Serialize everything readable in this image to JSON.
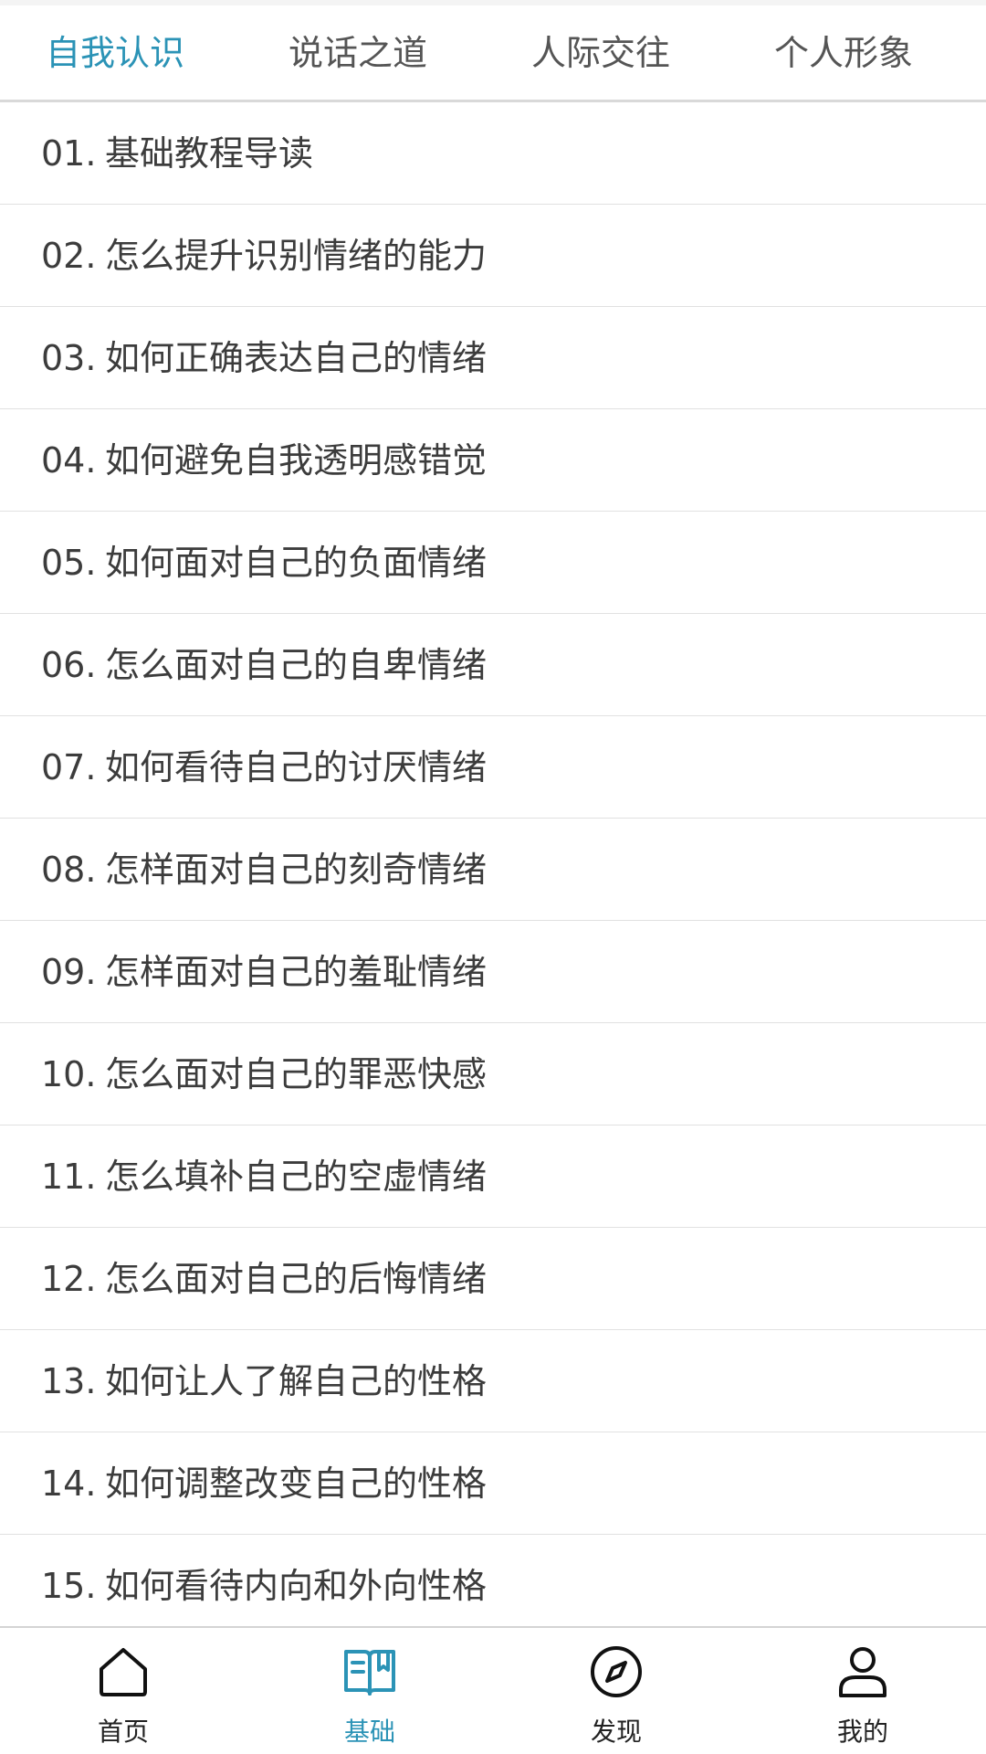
{
  "colors": {
    "accent": "#2b93b6",
    "text": "#3c3c3c",
    "tab_inactive": "#555555",
    "divider": "#e1e1e1"
  },
  "tabs": [
    {
      "label": "自我认识",
      "active": true
    },
    {
      "label": "说话之道",
      "active": false
    },
    {
      "label": "人际交往",
      "active": false
    },
    {
      "label": "个人形象",
      "active": false
    }
  ],
  "lessons": [
    {
      "num": "01.",
      "title": "基础教程导读"
    },
    {
      "num": "02.",
      "title": "怎么提升识别情绪的能力"
    },
    {
      "num": "03.",
      "title": "如何正确表达自己的情绪"
    },
    {
      "num": "04.",
      "title": "如何避免自我透明感错觉"
    },
    {
      "num": "05.",
      "title": "如何面对自己的负面情绪"
    },
    {
      "num": "06.",
      "title": "怎么面对自己的自卑情绪"
    },
    {
      "num": "07.",
      "title": "如何看待自己的讨厌情绪"
    },
    {
      "num": "08.",
      "title": "怎样面对自己的刻奇情绪"
    },
    {
      "num": "09.",
      "title": "怎样面对自己的羞耻情绪"
    },
    {
      "num": "10.",
      "title": "怎么面对自己的罪恶快感"
    },
    {
      "num": "11.",
      "title": "怎么填补自己的空虚情绪"
    },
    {
      "num": "12.",
      "title": "怎么面对自己的后悔情绪"
    },
    {
      "num": "13.",
      "title": "如何让人了解自己的性格"
    },
    {
      "num": "14.",
      "title": "如何调整改变自己的性格"
    },
    {
      "num": "15.",
      "title": "如何看待内向和外向性格"
    }
  ],
  "bottom_nav": [
    {
      "label": "首页",
      "icon": "home-icon",
      "active": false
    },
    {
      "label": "基础",
      "icon": "book-icon",
      "active": true
    },
    {
      "label": "发现",
      "icon": "compass-icon",
      "active": false
    },
    {
      "label": "我的",
      "icon": "user-icon",
      "active": false
    }
  ]
}
